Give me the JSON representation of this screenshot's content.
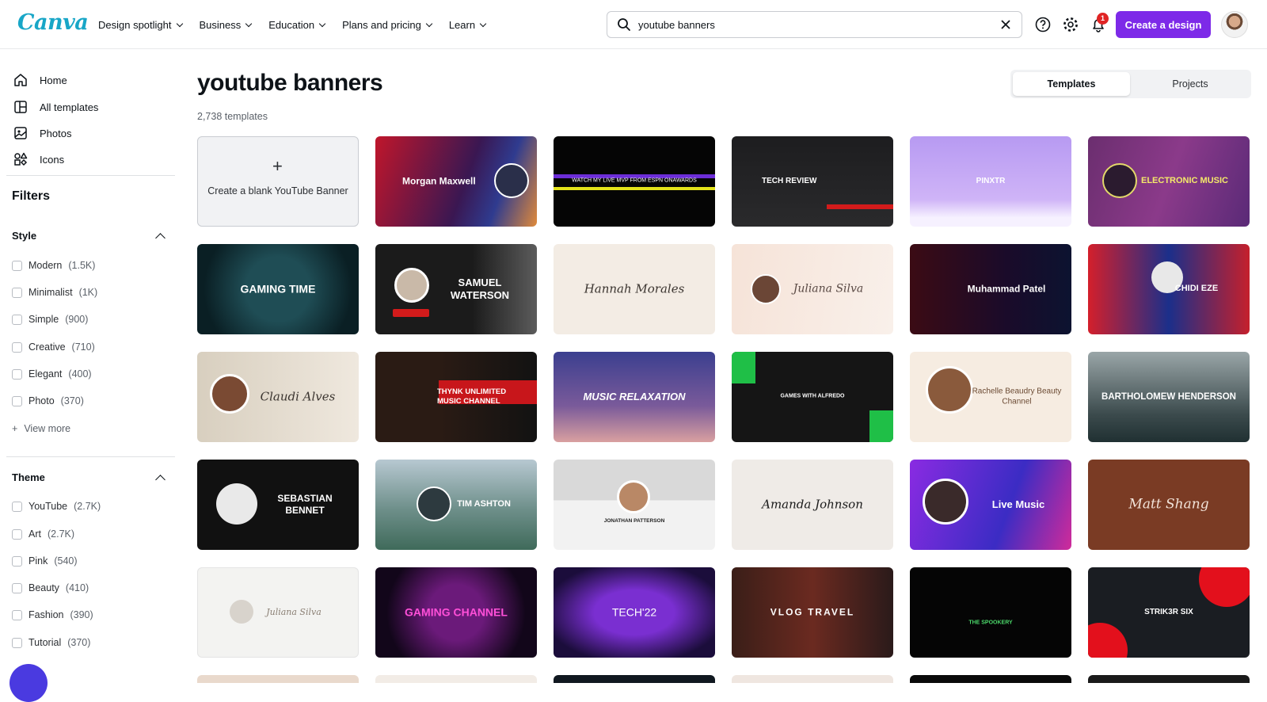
{
  "brand": {
    "logo_text": "Canva",
    "accent": "#7d2ae8",
    "logo_color": "#18a6c7"
  },
  "nav": {
    "items": [
      "Design spotlight",
      "Business",
      "Education",
      "Plans and pricing",
      "Learn"
    ]
  },
  "search": {
    "value": "youtube banners",
    "icon": "search-icon"
  },
  "header": {
    "notification_count": "1",
    "create_label": "Create a design",
    "icons": [
      "help-icon",
      "settings-icon",
      "bell-icon"
    ]
  },
  "sidebar": {
    "links": [
      {
        "label": "Home",
        "icon": "home-icon"
      },
      {
        "label": "All templates",
        "icon": "templates-icon"
      },
      {
        "label": "Photos",
        "icon": "photos-icon"
      },
      {
        "label": "Icons",
        "icon": "shapes-icon"
      }
    ],
    "filters_title": "Filters",
    "style": {
      "title": "Style",
      "options": [
        {
          "label": "Modern",
          "count": "(1.5K)"
        },
        {
          "label": "Minimalist",
          "count": "(1K)"
        },
        {
          "label": "Simple",
          "count": "(900)"
        },
        {
          "label": "Creative",
          "count": "(710)"
        },
        {
          "label": "Elegant",
          "count": "(400)"
        },
        {
          "label": "Photo",
          "count": "(370)"
        }
      ],
      "view_more": "View more"
    },
    "theme": {
      "title": "Theme",
      "options": [
        {
          "label": "YouTube",
          "count": "(2.7K)"
        },
        {
          "label": "Art",
          "count": "(2.7K)"
        },
        {
          "label": "Pink",
          "count": "(540)"
        },
        {
          "label": "Beauty",
          "count": "(410)"
        },
        {
          "label": "Fashion",
          "count": "(390)"
        },
        {
          "label": "Tutorial",
          "count": "(370)"
        }
      ]
    }
  },
  "main": {
    "title": "youtube banners",
    "count": "2,738 templates",
    "tabs": [
      "Templates",
      "Projects"
    ],
    "blank_card": {
      "plus": "+",
      "label": "Create a blank YouTube Banner"
    },
    "templates": [
      {
        "text": "Morgan Maxwell"
      },
      {
        "text": "WATCH MY LIVE MVP FROM ESPN ONAWARDS"
      },
      {
        "text": "TECH REVIEW"
      },
      {
        "text": "PINXTR"
      },
      {
        "text": "ELECTRONIC MUSIC"
      },
      {
        "text": "GAMING TIME"
      },
      {
        "text": "SAMUEL WATERSON"
      },
      {
        "text": "Hannah Morales"
      },
      {
        "text": "Juliana Silva"
      },
      {
        "text": "Muhammad Patel"
      },
      {
        "text": "CHIDI EZE"
      },
      {
        "text": "Claudi Alves"
      },
      {
        "text": "THYNK UNLIMITED MUSIC CHANNEL"
      },
      {
        "text": "MUSIC RELAXATION"
      },
      {
        "text": "GAMES WITH ALFREDO"
      },
      {
        "text": "Rachelle Beaudry Beauty Channel"
      },
      {
        "text": "BARTHOLOMEW HENDERSON"
      },
      {
        "text": "SEBASTIAN BENNET"
      },
      {
        "text": "TIM ASHTON"
      },
      {
        "text": "JONATHAN PATTERSON"
      },
      {
        "text": "Amanda Johnson"
      },
      {
        "text": "Live Music"
      },
      {
        "text": "Matt Shang"
      },
      {
        "text": "Juliana Silva"
      },
      {
        "text": "GAMING CHANNEL"
      },
      {
        "text": "TECH'22"
      },
      {
        "text": "VLOG TRAVEL"
      },
      {
        "text": "THE SPOOKERY"
      },
      {
        "text": "STRIK3R SIX"
      }
    ]
  }
}
